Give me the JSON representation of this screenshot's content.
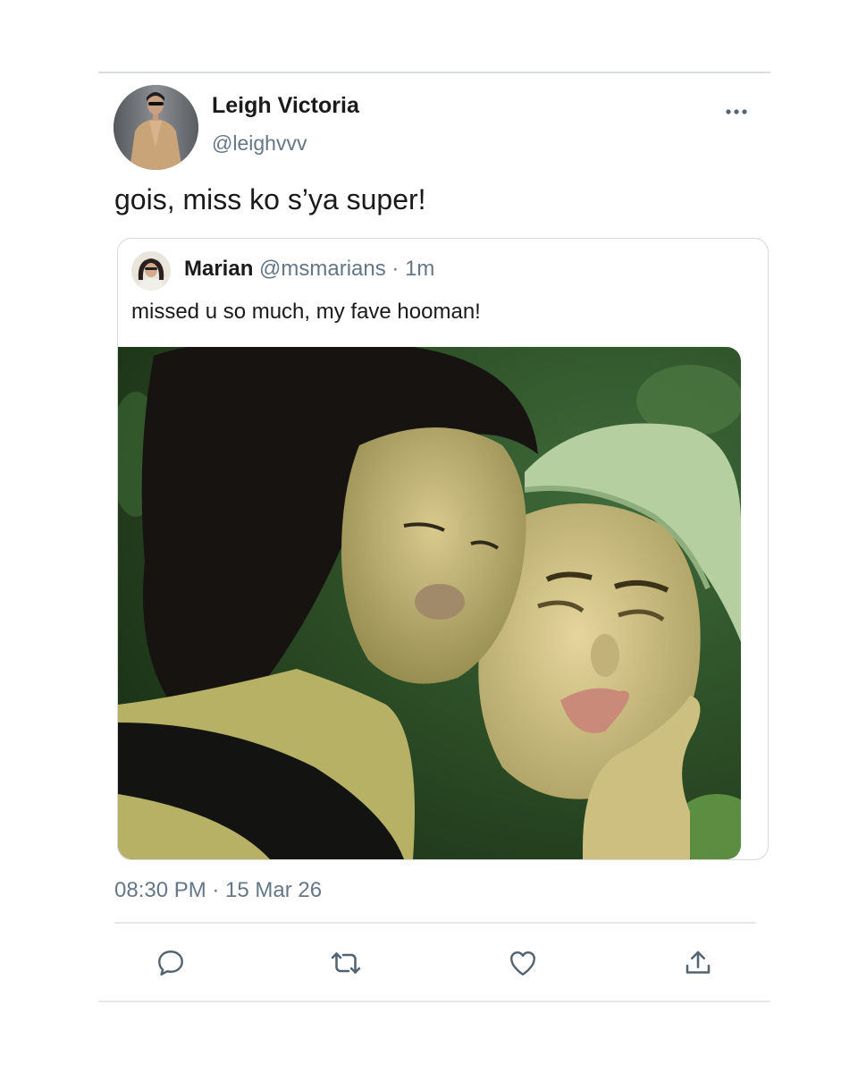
{
  "tweet": {
    "author_name": "Leigh Victoria",
    "author_handle": "@leighvvv",
    "text": "gois, miss ko s’ya super!",
    "timestamp": "08:30 PM · 15 Mar 26"
  },
  "quoted": {
    "author_name": "Marian",
    "meta": "@msmarians · 1m",
    "text": "missed u so much, my fave hooman!"
  },
  "icons": {
    "more": "more-horizontal-icon",
    "reply": "reply-icon",
    "retweet": "retweet-icon",
    "like": "heart-icon",
    "share": "share-icon"
  },
  "colors": {
    "secondary_text": "#657786",
    "divider": "#d9dde0",
    "icon": "#536471"
  }
}
